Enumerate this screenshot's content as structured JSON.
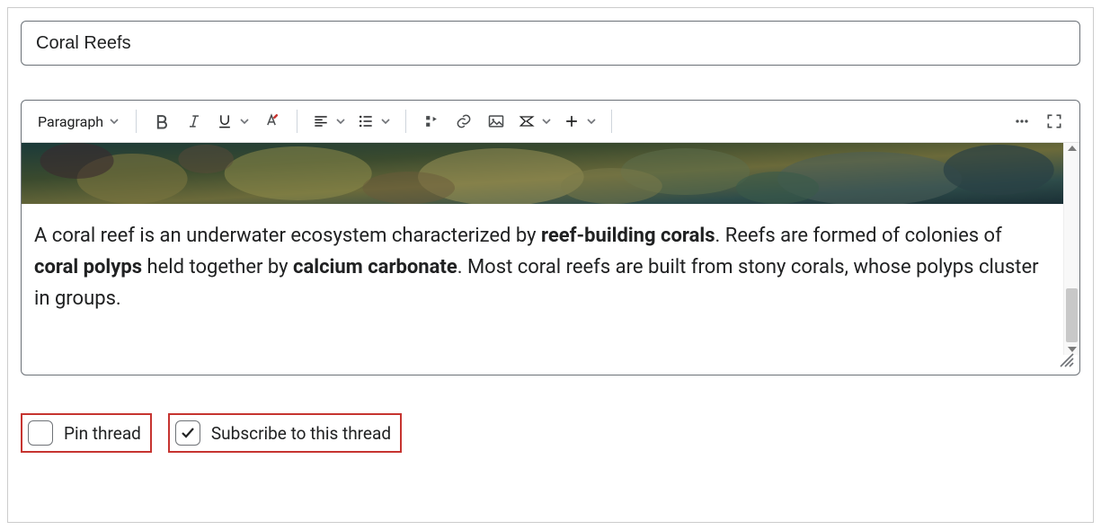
{
  "title": "Coral Reefs",
  "toolbar": {
    "paragraph_label": "Paragraph"
  },
  "content": {
    "body_html": "A coral reef is an underwater ecosystem characterized by <b>reef-building corals</b>. Reefs are formed of colonies of <b>coral polyps</b> held together by <b>calcium carbonate</b>. Most coral reefs are built from stony corals, whose polyps cluster in groups."
  },
  "options": {
    "pin_label": "Pin thread",
    "pin_checked": false,
    "subscribe_label": "Subscribe to this thread",
    "subscribe_checked": true
  }
}
